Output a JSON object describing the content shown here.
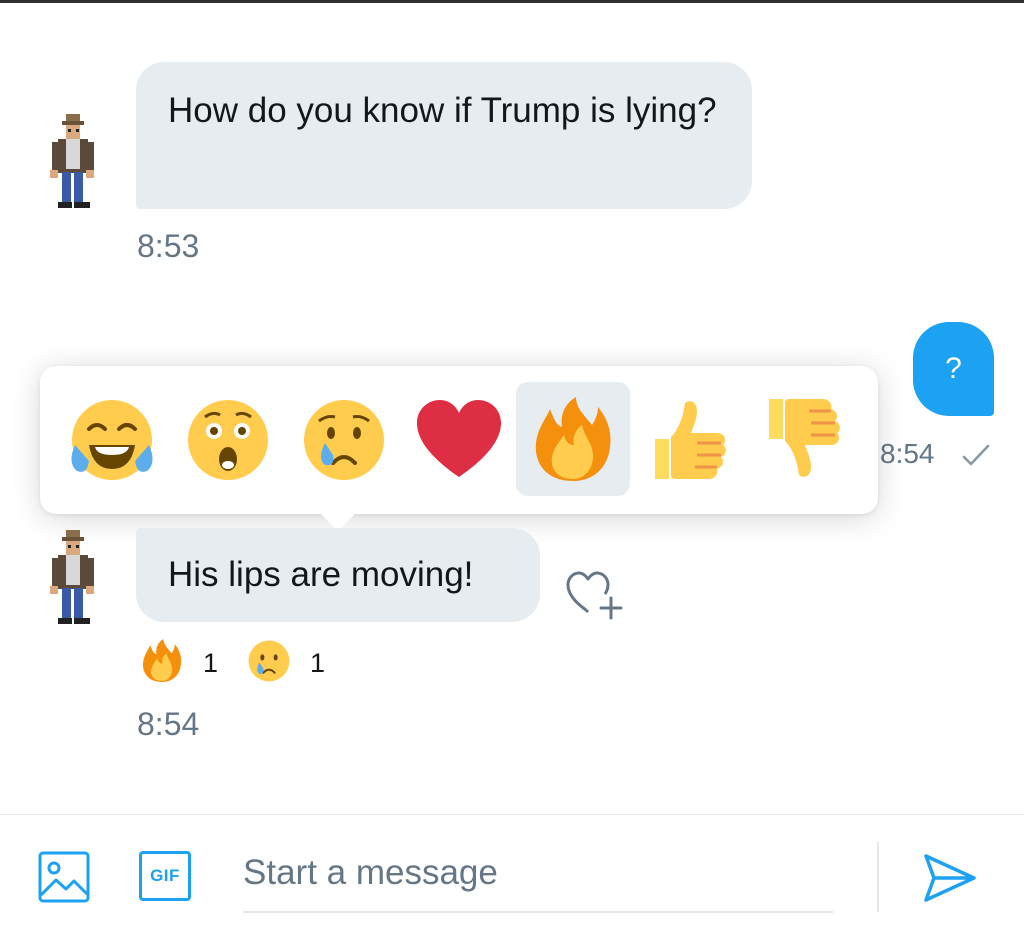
{
  "conversation": {
    "messages": [
      {
        "direction": "incoming",
        "text": "How do you know if Trump is lying?",
        "time": "8:53"
      },
      {
        "direction": "outgoing",
        "text": "?",
        "time": "8:54",
        "status": "sent-check"
      },
      {
        "direction": "incoming",
        "text": "His lips are moving!",
        "time": "8:54",
        "reactions": [
          {
            "icon": "fire-emoji",
            "count": "1"
          },
          {
            "icon": "crying-face-emoji",
            "count": "1"
          }
        ]
      }
    ]
  },
  "reaction_picker": {
    "options": [
      "tears-of-joy-emoji",
      "astonished-face-emoji",
      "crying-face-emoji",
      "red-heart-emoji",
      "fire-emoji",
      "thumbs-up-emoji",
      "thumbs-down-emoji"
    ],
    "selected": "fire-emoji"
  },
  "composer": {
    "placeholder": "Start a message",
    "gif_label": "GIF"
  },
  "colors": {
    "accent": "#1da1f2",
    "incoming_bubble": "#e6ecf0",
    "secondary_text": "#657786"
  }
}
